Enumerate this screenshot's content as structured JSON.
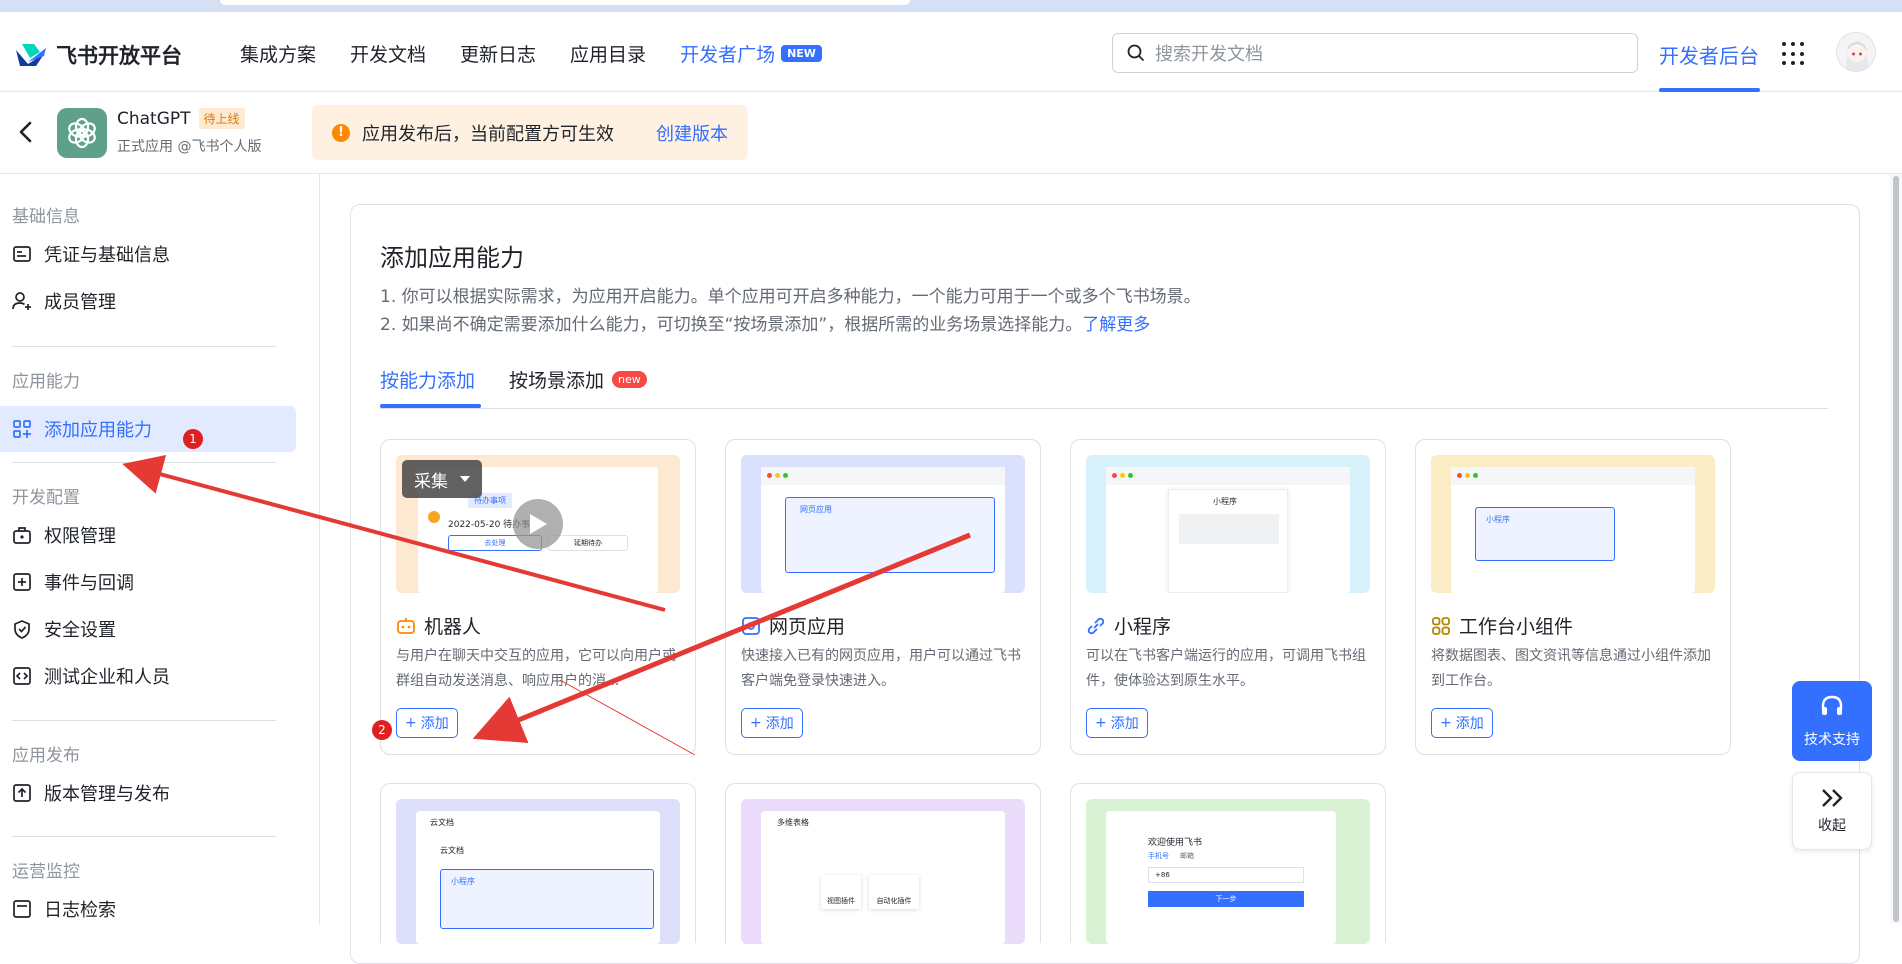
{
  "brand": {
    "name": "飞书开放平台",
    "accent": "#3370ff"
  },
  "nav": {
    "links": [
      "集成方案",
      "开发文档",
      "更新日志",
      "应用目录"
    ],
    "highlight_link": "开发者广场",
    "highlight_badge": "NEW",
    "search_placeholder": "搜索开发文档",
    "dev_backend": "开发者后台"
  },
  "app": {
    "name": "ChatGPT",
    "status": "待上线",
    "subtitle": "正式应用 @飞书个人版",
    "notice": "应用发布后，当前配置方可生效",
    "notice_link": "创建版本"
  },
  "sidebar": {
    "group_basic": "基础信息",
    "item_credentials": "凭证与基础信息",
    "item_members": "成员管理",
    "group_capabilities": "应用能力",
    "item_add_capability": "添加应用能力",
    "group_dev_config": "开发配置",
    "item_permissions": "权限管理",
    "item_events": "事件与回调",
    "item_security": "安全设置",
    "item_test": "测试企业和人员",
    "group_release": "应用发布",
    "item_versions": "版本管理与发布",
    "group_ops": "运营监控",
    "item_logs": "日志检索"
  },
  "main": {
    "title": "添加应用能力",
    "desc_line1": "1. 你可以根据实际需求，为应用开启能力。单个应用可开启多种能力，一个能力可用于一个或多个飞书场景。",
    "desc_line2": "2. 如果尚不确定需要添加什么能力，可切换至“按场景添加”，根据所需的业务场景选择能力。",
    "desc_link": "了解更多",
    "tab_by_capability": "按能力添加",
    "tab_by_scene": "按场景添加",
    "tab_scene_badge": "new",
    "add_label": "添加",
    "cards": [
      {
        "title": "机器人",
        "desc": "与用户在聊天中交互的应用，它可以向用户或群组自动发送消息、响应用户的消..."
      },
      {
        "title": "网页应用",
        "desc": "快速接入已有的网页应用，用户可以通过飞书客户端免登录快速进入。"
      },
      {
        "title": "小程序",
        "desc": "可以在飞书客户端运行的应用，可调用飞书组件，使体验达到原生水平。"
      },
      {
        "title": "工作台小组件",
        "desc": "将数据图表、图文资讯等信息通过小组件添加到工作台。"
      }
    ],
    "preview_text": {
      "bot_tab": "待办事项",
      "bot_date": "2022-05-20 待办事项",
      "bot_btn1": "去处理",
      "bot_btn2": "延期待办",
      "web_label": "网页应用",
      "mini_title": "小程序",
      "widget_label": "小程序",
      "doc_title": "云文档",
      "doc_sub": "云文档",
      "doc_widget": "小程序",
      "table_title": "多维表格",
      "table_btn1": "视图插件",
      "table_btn2": "自动化插件",
      "login_title": "欢迎使用飞书",
      "login_tab1": "手机号",
      "login_tab2": "邮箱",
      "login_code": "+86",
      "login_btn": "下一步"
    }
  },
  "overlay": {
    "collect_label": "采集",
    "badge1": "1",
    "badge2": "2"
  },
  "float": {
    "support": "技术支持",
    "collapse": "收起"
  }
}
